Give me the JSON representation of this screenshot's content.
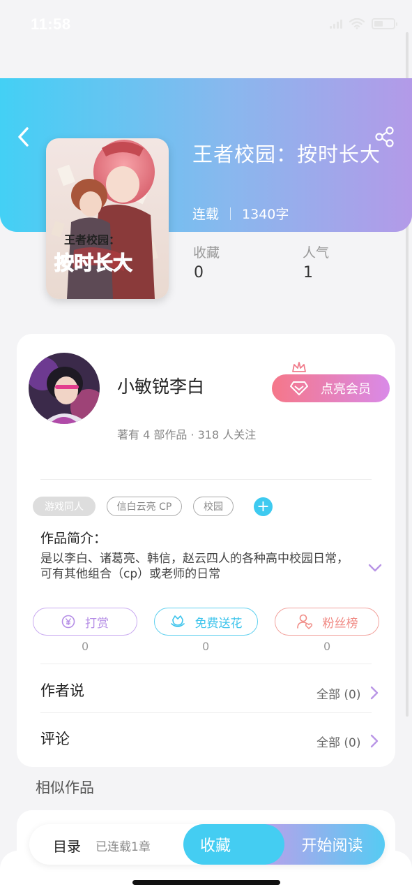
{
  "status_bar": {
    "time": "11:58"
  },
  "book": {
    "title": "王者校园：按时长大",
    "status": "连载",
    "word_count": "1340字",
    "cover": {
      "line1": "王者校园：",
      "line2": "按时长大"
    }
  },
  "stats": [
    {
      "label": "收藏",
      "value": "0"
    },
    {
      "label": "人气",
      "value": "1"
    }
  ],
  "author": {
    "name": "小敏锐李白",
    "stats": "著有 4 部作品 · 318 人关注",
    "vip_label": "点亮会员"
  },
  "tags": [
    "游戏同人",
    "信白云亮 CP",
    "校园"
  ],
  "intro": {
    "label": "作品简介：",
    "text": "是以李白、诸葛亮、韩信，赵云四人的各种高中校园日常，可有其他组合（cp）或老师的日常"
  },
  "actions": [
    {
      "label": "打赏",
      "count": "0",
      "icon": "yen-coin-icon",
      "color": "#b58ee6"
    },
    {
      "label": "免费送花",
      "count": "0",
      "icon": "flower-icon",
      "color": "#3ec4ec"
    },
    {
      "label": "粉丝榜",
      "count": "0",
      "icon": "user-heart-icon",
      "color": "#f08a84"
    }
  ],
  "rows": {
    "author_says": {
      "label": "作者说",
      "right": "全部 (0)"
    },
    "comments": {
      "label": "评论",
      "right": "全部 (0)"
    }
  },
  "similar": {
    "title": "相似作品"
  },
  "bottom": {
    "toc_label": "目录",
    "toc_count": "已连载1章",
    "favorite_label": "收藏",
    "read_label": "开始阅读"
  },
  "colors": {
    "hero_gradient": [
      "#43d0f5",
      "#b39ae8"
    ],
    "accent_blue": "#44cdf2",
    "vip_gradient": [
      "#f57789",
      "#d98ae8"
    ]
  }
}
